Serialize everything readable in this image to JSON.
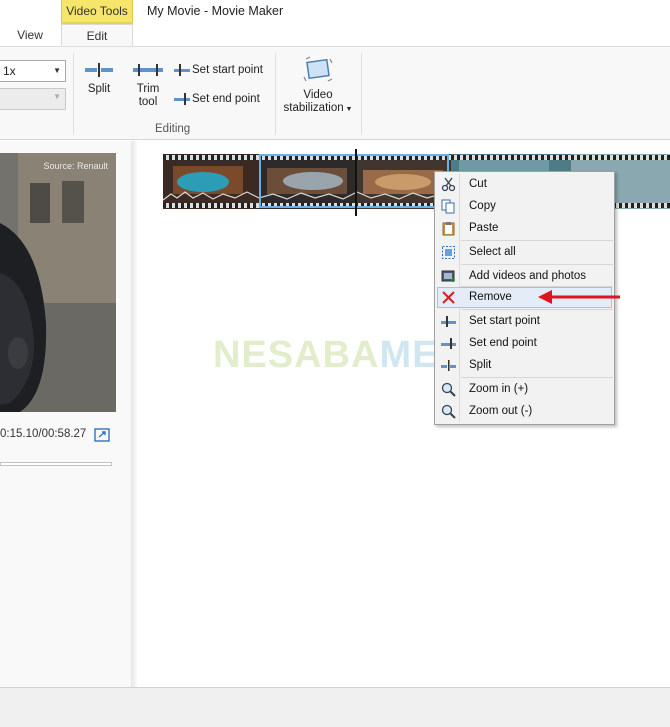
{
  "window": {
    "title": "My Movie - Movie Maker",
    "contextual_tab_group": "Video Tools"
  },
  "tabs": [
    {
      "label": "View",
      "active": false
    },
    {
      "label": "Edit",
      "active": true
    }
  ],
  "ribbon": {
    "speed_dropdown_value": "1x",
    "split_label": "Split",
    "trim_tool_label": "Trim tool",
    "set_start_point_label": "Set start point",
    "set_end_point_label": "Set end point",
    "editing_group_label": "Editing",
    "video_stabilization_label": "Video stabilization"
  },
  "preview": {
    "source_text": "Source: Renault",
    "time_readout": "0:15.10/00:58.27"
  },
  "watermark": {
    "part_a": "NESABA",
    "part_b": "MEDIA"
  },
  "context_menu": {
    "items": [
      {
        "label": "Cut",
        "icon": "scissors-icon"
      },
      {
        "label": "Copy",
        "icon": "copy-icon"
      },
      {
        "label": "Paste",
        "icon": "paste-icon"
      },
      {
        "label": "Select all",
        "icon": "select-all-icon"
      },
      {
        "label": "Add videos and photos",
        "icon": "add-media-icon"
      },
      {
        "label": "Remove",
        "icon": "remove-x-icon",
        "highlighted": true
      },
      {
        "label": "Set start point",
        "icon": "set-start-icon"
      },
      {
        "label": "Set end point",
        "icon": "set-end-icon"
      },
      {
        "label": "Split",
        "icon": "split-icon"
      },
      {
        "label": "Zoom in (+)",
        "icon": "zoom-in-icon"
      },
      {
        "label": "Zoom out (-)",
        "icon": "zoom-out-icon"
      }
    ]
  },
  "colors": {
    "contextual_tab": "#f6e56b",
    "selection_border": "#6ab0e6",
    "annotation_arrow": "#e0141e",
    "menu_highlight": "#e3ecf7"
  }
}
